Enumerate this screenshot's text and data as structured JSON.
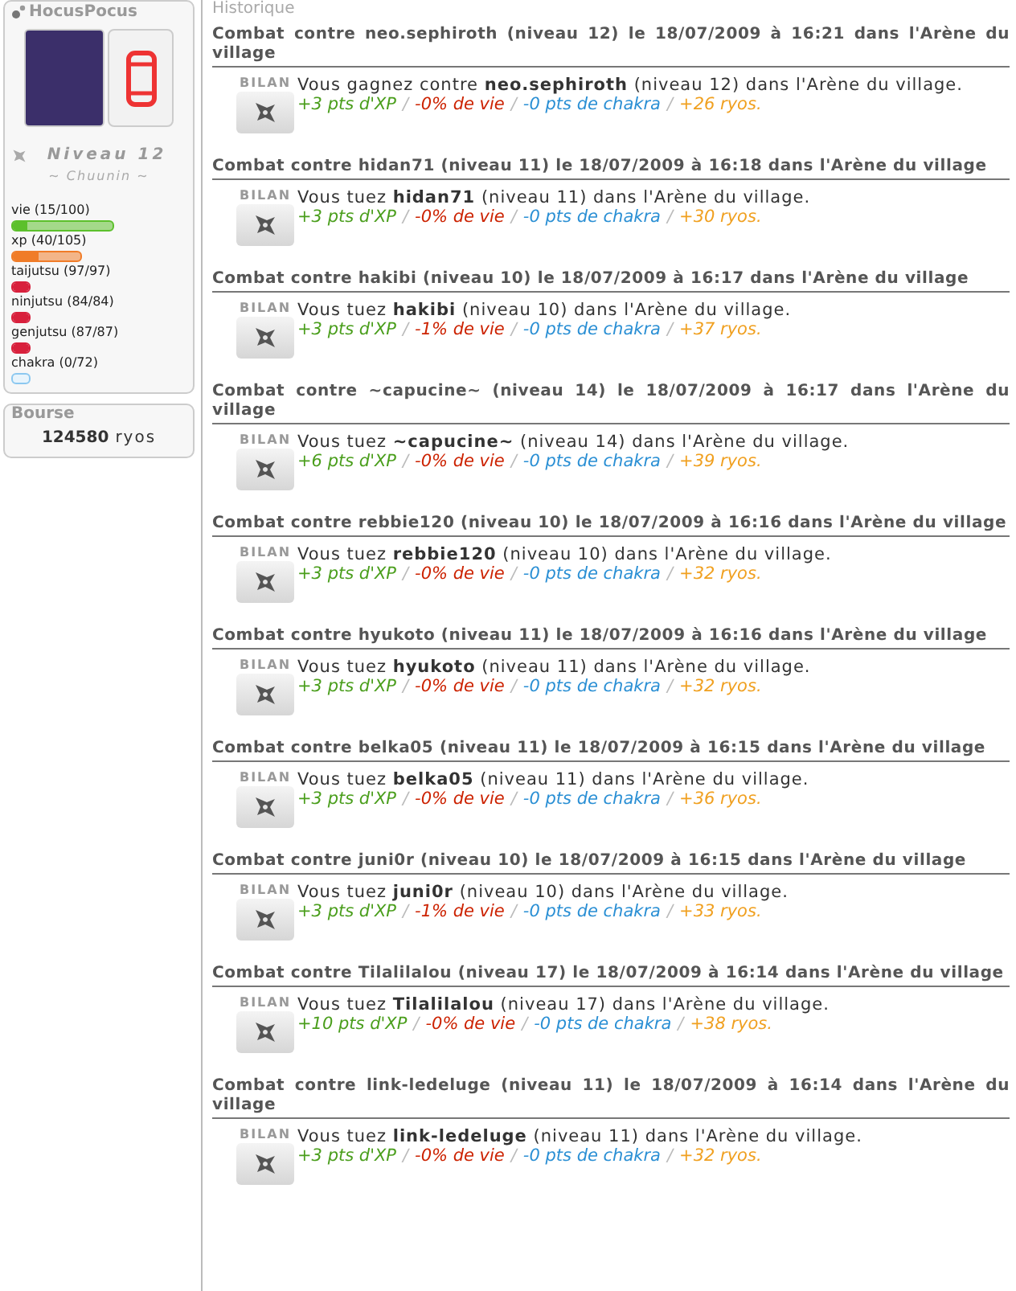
{
  "profile": {
    "username": "HocusPocus",
    "level": "Niveau 12",
    "rank": "~ Chuunin ~",
    "stats": [
      {
        "label": "vie (15/100)",
        "kind": "long",
        "level": 0.15,
        "color": "#5cc02c"
      },
      {
        "label": "xp (40/105)",
        "kind": "medium",
        "level": 0.38,
        "color": "#f07c28"
      },
      {
        "label": "taijutsu (97/97)",
        "kind": "short",
        "level": 1,
        "color": "#d8203c"
      },
      {
        "label": "ninjutsu (84/84)",
        "kind": "short",
        "level": 1,
        "color": "#d8203c"
      },
      {
        "label": "genjutsu (87/87)",
        "kind": "short",
        "level": 1,
        "color": "#d8203c"
      },
      {
        "label": "chakra (0/72)",
        "kind": "short",
        "level": 0,
        "color": "#8cc8f0"
      }
    ]
  },
  "bourse": {
    "title": "Bourse",
    "amount": "124580",
    "unit": "ryos"
  },
  "history": {
    "title": "Historique",
    "separator": "/",
    "entries": [
      {
        "heading": "Combat contre neo.sephiroth (niveau 12) le 18/07/2009 à 16:21 dans l'Arène du village",
        "label": "BILAN",
        "result": "Vous gagnez contre **neo.sephiroth** (niveau 12) dans l'Arène du village.",
        "gains": [
          {
            "kind": "xp",
            "text": "+3 pts d'XP"
          },
          {
            "kind": "vie",
            "text": "-0% de vie"
          },
          {
            "kind": "chakra",
            "text": "-0 pts de chakra"
          },
          {
            "kind": "ryos",
            "text": "+26 ryos."
          }
        ]
      },
      {
        "heading": "Combat contre hidan71 (niveau 11) le 18/07/2009 à 16:18 dans l'Arène du village",
        "label": "BILAN",
        "result": "Vous tuez **hidan71** (niveau 11) dans l'Arène du village.",
        "gains": [
          {
            "kind": "xp",
            "text": "+3 pts d'XP"
          },
          {
            "kind": "vie",
            "text": "-0% de vie"
          },
          {
            "kind": "chakra",
            "text": "-0 pts de chakra"
          },
          {
            "kind": "ryos",
            "text": "+30 ryos."
          }
        ]
      },
      {
        "heading": "Combat contre hakibi (niveau 10) le 18/07/2009 à 16:17 dans l'Arène du village",
        "label": "BILAN",
        "result": "Vous tuez **hakibi** (niveau 10) dans l'Arène du village.",
        "gains": [
          {
            "kind": "xp",
            "text": "+3 pts d'XP"
          },
          {
            "kind": "vie",
            "text": "-1% de vie"
          },
          {
            "kind": "chakra",
            "text": "-0 pts de chakra"
          },
          {
            "kind": "ryos",
            "text": "+37 ryos."
          }
        ]
      },
      {
        "heading": "Combat contre ~capucine~ (niveau 14) le 18/07/2009 à 16:17 dans l'Arène du village",
        "label": "BILAN",
        "result": "Vous tuez **~capucine~** (niveau 14) dans l'Arène du village.",
        "gains": [
          {
            "kind": "xp",
            "text": "+6 pts d'XP"
          },
          {
            "kind": "vie",
            "text": "-0% de vie"
          },
          {
            "kind": "chakra",
            "text": "-0 pts de chakra"
          },
          {
            "kind": "ryos",
            "text": "+39 ryos."
          }
        ]
      },
      {
        "heading": "Combat contre rebbie120 (niveau 10) le 18/07/2009 à 16:16 dans l'Arène du village",
        "label": "BILAN",
        "result": "Vous tuez **rebbie120** (niveau 10) dans l'Arène du village.",
        "gains": [
          {
            "kind": "xp",
            "text": "+3 pts d'XP"
          },
          {
            "kind": "vie",
            "text": "-0% de vie"
          },
          {
            "kind": "chakra",
            "text": "-0 pts de chakra"
          },
          {
            "kind": "ryos",
            "text": "+32 ryos."
          }
        ]
      },
      {
        "heading": "Combat contre hyukoto (niveau 11) le 18/07/2009 à 16:16 dans l'Arène du village",
        "label": "BILAN",
        "result": "Vous tuez **hyukoto** (niveau 11) dans l'Arène du village.",
        "gains": [
          {
            "kind": "xp",
            "text": "+3 pts d'XP"
          },
          {
            "kind": "vie",
            "text": "-0% de vie"
          },
          {
            "kind": "chakra",
            "text": "-0 pts de chakra"
          },
          {
            "kind": "ryos",
            "text": "+32 ryos."
          }
        ]
      },
      {
        "heading": "Combat contre belka05 (niveau 11) le 18/07/2009 à 16:15 dans l'Arène du village",
        "label": "BILAN",
        "result": "Vous tuez **belka05** (niveau 11) dans l'Arène du village.",
        "gains": [
          {
            "kind": "xp",
            "text": "+3 pts d'XP"
          },
          {
            "kind": "vie",
            "text": "-0% de vie"
          },
          {
            "kind": "chakra",
            "text": "-0 pts de chakra"
          },
          {
            "kind": "ryos",
            "text": "+36 ryos."
          }
        ]
      },
      {
        "heading": "Combat contre juni0r (niveau 10) le 18/07/2009 à 16:15 dans l'Arène du village",
        "label": "BILAN",
        "result": "Vous tuez **juni0r** (niveau 10) dans l'Arène du village.",
        "gains": [
          {
            "kind": "xp",
            "text": "+3 pts d'XP"
          },
          {
            "kind": "vie",
            "text": "-1% de vie"
          },
          {
            "kind": "chakra",
            "text": "-0 pts de chakra"
          },
          {
            "kind": "ryos",
            "text": "+33 ryos."
          }
        ]
      },
      {
        "heading": "Combat contre Tilalilalou (niveau 17) le 18/07/2009 à 16:14 dans l'Arène du village",
        "label": "BILAN",
        "result": "Vous tuez **Tilalilalou** (niveau 17) dans l'Arène du village.",
        "gains": [
          {
            "kind": "xp",
            "text": "+10 pts d'XP"
          },
          {
            "kind": "vie",
            "text": "-0% de vie"
          },
          {
            "kind": "chakra",
            "text": "-0 pts de chakra"
          },
          {
            "kind": "ryos",
            "text": "+38 ryos."
          }
        ]
      },
      {
        "heading": "Combat contre link-ledeluge (niveau 11) le 18/07/2009 à 16:14 dans l'Arène du village",
        "label": "BILAN",
        "result": "Vous tuez **link-ledeluge** (niveau 11) dans l'Arène du village.",
        "gains": [
          {
            "kind": "xp",
            "text": "+3 pts d'XP"
          },
          {
            "kind": "vie",
            "text": "-0% de vie"
          },
          {
            "kind": "chakra",
            "text": "-0 pts de chakra"
          },
          {
            "kind": "ryos",
            "text": "+32 ryos."
          }
        ]
      }
    ]
  }
}
